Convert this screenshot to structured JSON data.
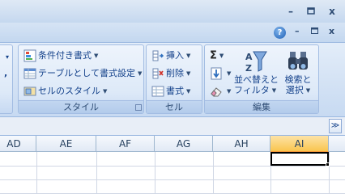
{
  "window": {
    "minimize_glyph": "–",
    "restore_glyph": "▫",
    "close_glyph": "x"
  },
  "workbook": {
    "help_glyph": "?",
    "minimize_glyph": "–",
    "restore_glyph": "▫",
    "close_glyph": "x"
  },
  "ribbon": {
    "left_stub": {
      "arrow": "▾",
      "comma": ","
    },
    "style_group": {
      "label": "スタイル",
      "items": [
        {
          "label": "条件付き書式",
          "icon": "conditional-format-icon"
        },
        {
          "label": "テーブルとして書式設定",
          "icon": "table-format-icon"
        },
        {
          "label": "セルのスタイル",
          "icon": "cell-style-icon"
        }
      ]
    },
    "cells_group": {
      "label": "セル",
      "items": [
        {
          "label": "挿入",
          "icon": "insert-icon"
        },
        {
          "label": "削除",
          "icon": "delete-icon"
        },
        {
          "label": "書式",
          "icon": "format-icon"
        }
      ]
    },
    "edit_group": {
      "label": "編集",
      "sum_glyph": "Σ",
      "sort_filter": {
        "line1": "並べ替えと",
        "line2": "フィルタ"
      },
      "find_select": {
        "line1": "検索と",
        "line2": "選択"
      }
    }
  },
  "formula_bar": {
    "expand_glyph": "≫"
  },
  "columns": [
    {
      "name": "AD",
      "selected": false
    },
    {
      "name": "AE",
      "selected": false
    },
    {
      "name": "AF",
      "selected": false
    },
    {
      "name": "AG",
      "selected": false
    },
    {
      "name": "AH",
      "selected": false
    },
    {
      "name": "AI",
      "selected": true
    }
  ],
  "colors": {
    "accent": "#15428b",
    "selected_header": "#f9c54e",
    "grid_line": "#d0d7e5"
  }
}
